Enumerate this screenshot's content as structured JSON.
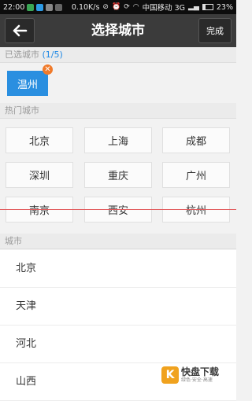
{
  "status_bar": {
    "time": "22:00",
    "speed": "0.10K/s",
    "carrier": "中国移动 3G",
    "battery": "23%"
  },
  "header": {
    "title": "选择城市",
    "done_label": "完成"
  },
  "selected": {
    "label": "已选城市",
    "count": "(1/5)",
    "chips": [
      "温州"
    ]
  },
  "hot": {
    "label": "热门城市",
    "cities": [
      "北京",
      "上海",
      "成都",
      "深圳",
      "重庆",
      "广州",
      "南京",
      "西安",
      "杭州"
    ]
  },
  "list": {
    "label": "城市",
    "cities": [
      "北京",
      "天津",
      "河北",
      "山西"
    ]
  },
  "watermark": {
    "title": "快盘下载",
    "subtitle": "绿色·安全·高速"
  },
  "colors": {
    "title_bar": "#3b3b3b",
    "chip": "#2a8fe0",
    "remove_badge": "#f07a2a",
    "count": "#1e88e5",
    "divider_line": "#e2585a"
  }
}
